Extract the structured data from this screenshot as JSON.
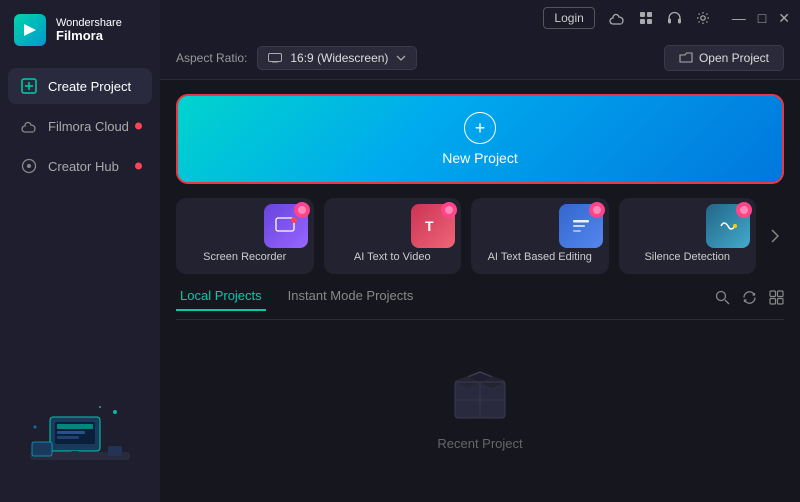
{
  "app": {
    "brand_top": "Wondershare",
    "brand_bottom": "Filmora"
  },
  "titlebar": {
    "login_label": "Login",
    "icons": [
      "cloud-icon",
      "grid-icon",
      "headphone-icon",
      "settings-icon"
    ]
  },
  "toolbar": {
    "aspect_label": "Aspect Ratio:",
    "aspect_icon": "monitor-icon",
    "aspect_value": "16:9 (Widescreen)",
    "open_project_label": "Open Project",
    "open_project_icon": "folder-icon"
  },
  "sidebar": {
    "nav_items": [
      {
        "id": "create-project",
        "label": "Create Project",
        "active": true,
        "dot": false
      },
      {
        "id": "filmora-cloud",
        "label": "Filmora Cloud",
        "active": false,
        "dot": true
      },
      {
        "id": "creator-hub",
        "label": "Creator Hub",
        "active": false,
        "dot": true
      }
    ]
  },
  "new_project": {
    "label": "New Project",
    "plus_icon": "plus-icon"
  },
  "feature_cards": [
    {
      "id": "screen-recorder",
      "label": "Screen Recorder",
      "thumb_color": "#6644dd"
    },
    {
      "id": "ai-text-to-video",
      "label": "AI Text to Video",
      "thumb_color": "#cc3355"
    },
    {
      "id": "ai-text-based-editing",
      "label": "AI Text Based Editing",
      "thumb_color": "#3366cc"
    },
    {
      "id": "silence-detection",
      "label": "Silence Detection",
      "thumb_color": "#226688"
    }
  ],
  "projects": {
    "tabs": [
      {
        "id": "local",
        "label": "Local Projects",
        "active": true
      },
      {
        "id": "instant",
        "label": "Instant Mode Projects",
        "active": false
      }
    ],
    "actions": [
      "search-icon",
      "refresh-icon",
      "grid-icon"
    ],
    "empty_label": "Recent Project"
  }
}
